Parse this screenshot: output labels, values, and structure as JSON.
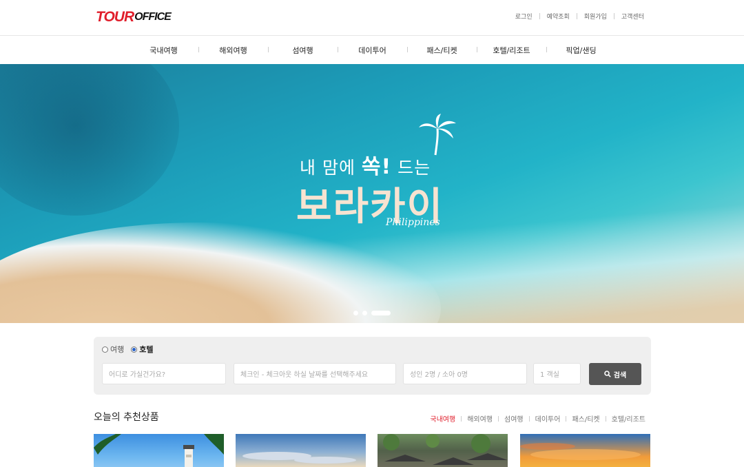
{
  "logo": {
    "part1": "TOUR",
    "part2": "OFFICE"
  },
  "util_links": [
    "로그인",
    "예약조회",
    "회원가입",
    "고객센터"
  ],
  "nav": [
    "국내여행",
    "해외여행",
    "섬여행",
    "데이투어",
    "패스/티켓",
    "호텔/리조트",
    "픽업/샌딩"
  ],
  "hero": {
    "line1_pre": "내 맘에 ",
    "line1_em": "쏙!",
    "line1_post": " 드는",
    "line2": "보라카이",
    "sub": "Philippines",
    "slide_count": 3,
    "active_slide": 3
  },
  "search": {
    "types": [
      {
        "label": "여행",
        "checked": false
      },
      {
        "label": "호텔",
        "checked": true
      }
    ],
    "destination_placeholder": "어디로 가실건가요?",
    "dates_placeholder": "체크인 - 체크아웃 하실 날짜를 선택해주세요",
    "guests": "성인 2명 / 소아 0명",
    "rooms": "1 객실",
    "button_label": "검색"
  },
  "recommend": {
    "title": "오늘의 추천상품",
    "tabs": [
      "국내여행",
      "해외여행",
      "섬여행",
      "데이투어",
      "패스/티켓",
      "호텔/리조트"
    ],
    "active_tab": 0
  },
  "colors": {
    "brand": "#e01e2b",
    "search_button": "#555555",
    "search_bg": "#efefef"
  }
}
